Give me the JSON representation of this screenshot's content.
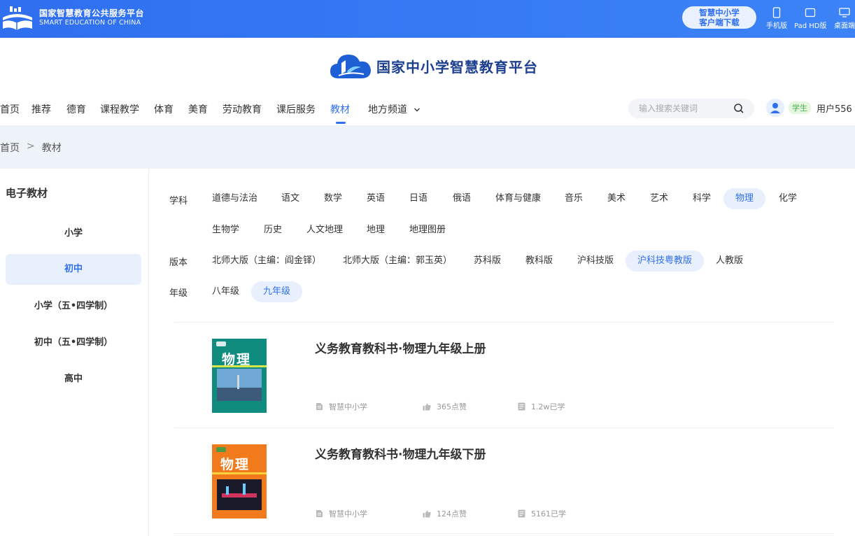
{
  "topbar": {
    "brand_cn": "国家智慧教育公共服务平台",
    "brand_en": "SMART EDUCATION OF CHINA",
    "download_line1": "智慧中小学",
    "download_line2": "客户端下载",
    "devices": [
      {
        "label": "手机版",
        "icon": "phone-icon"
      },
      {
        "label": "Pad HD版",
        "icon": "tablet-icon"
      },
      {
        "label": "桌面端",
        "icon": "desktop-icon"
      }
    ]
  },
  "header": {
    "site_title": "国家中小学智慧教育平台",
    "nav": [
      {
        "label": "首页"
      },
      {
        "label": "推荐"
      },
      {
        "label": "德育"
      },
      {
        "label": "课程教学"
      },
      {
        "label": "体育"
      },
      {
        "label": "美育"
      },
      {
        "label": "劳动教育"
      },
      {
        "label": "课后服务"
      },
      {
        "label": "教材",
        "active": true
      },
      {
        "label": "地方频道"
      }
    ],
    "search_placeholder": "输入搜索关键词",
    "role_badge": "学生",
    "username": "用户556"
  },
  "breadcrumb": [
    "首页",
    "教材"
  ],
  "breadcrumb_sep": ">",
  "sidebar": {
    "title": "电子教材",
    "items": [
      {
        "label": "小学"
      },
      {
        "label": "初中",
        "active": true
      },
      {
        "label": "小学（五•四学制）"
      },
      {
        "label": "初中（五•四学制）"
      },
      {
        "label": "高中"
      }
    ]
  },
  "filters": {
    "subject_label": "学科",
    "subjects": [
      "道德与法治",
      "语文",
      "数学",
      "英语",
      "日语",
      "俄语",
      "体育与健康",
      "音乐",
      "美术",
      "艺术",
      "科学",
      "物理",
      "化学",
      "生物学",
      "历史",
      "人文地理",
      "地理",
      "地理图册"
    ],
    "subject_active": "物理",
    "edition_label": "版本",
    "editions": [
      "北师大版（主编：阎金铎）",
      "北师大版（主编：郭玉英）",
      "苏科版",
      "教科版",
      "沪科技版",
      "沪科技粤教版",
      "人教版"
    ],
    "edition_active": "沪科技粤教版",
    "grade_label": "年级",
    "grades": [
      "八年级",
      "九年级"
    ],
    "grade_active": "九年级"
  },
  "books": [
    {
      "title": "义务教育教科书·物理九年级上册",
      "source": "智慧中小学",
      "likes": "365点赞",
      "learners": "1.2w已学",
      "cover_color": "#0f8c7e",
      "cover_text": "物理"
    },
    {
      "title": "义务教育教科书·物理九年级下册",
      "source": "智慧中小学",
      "likes": "124点赞",
      "learners": "5161已学",
      "cover_color": "#f07a1c",
      "cover_text": "物理"
    }
  ],
  "colors": {
    "primary": "#2f6ff0",
    "active_bg": "#e9f0fd"
  }
}
